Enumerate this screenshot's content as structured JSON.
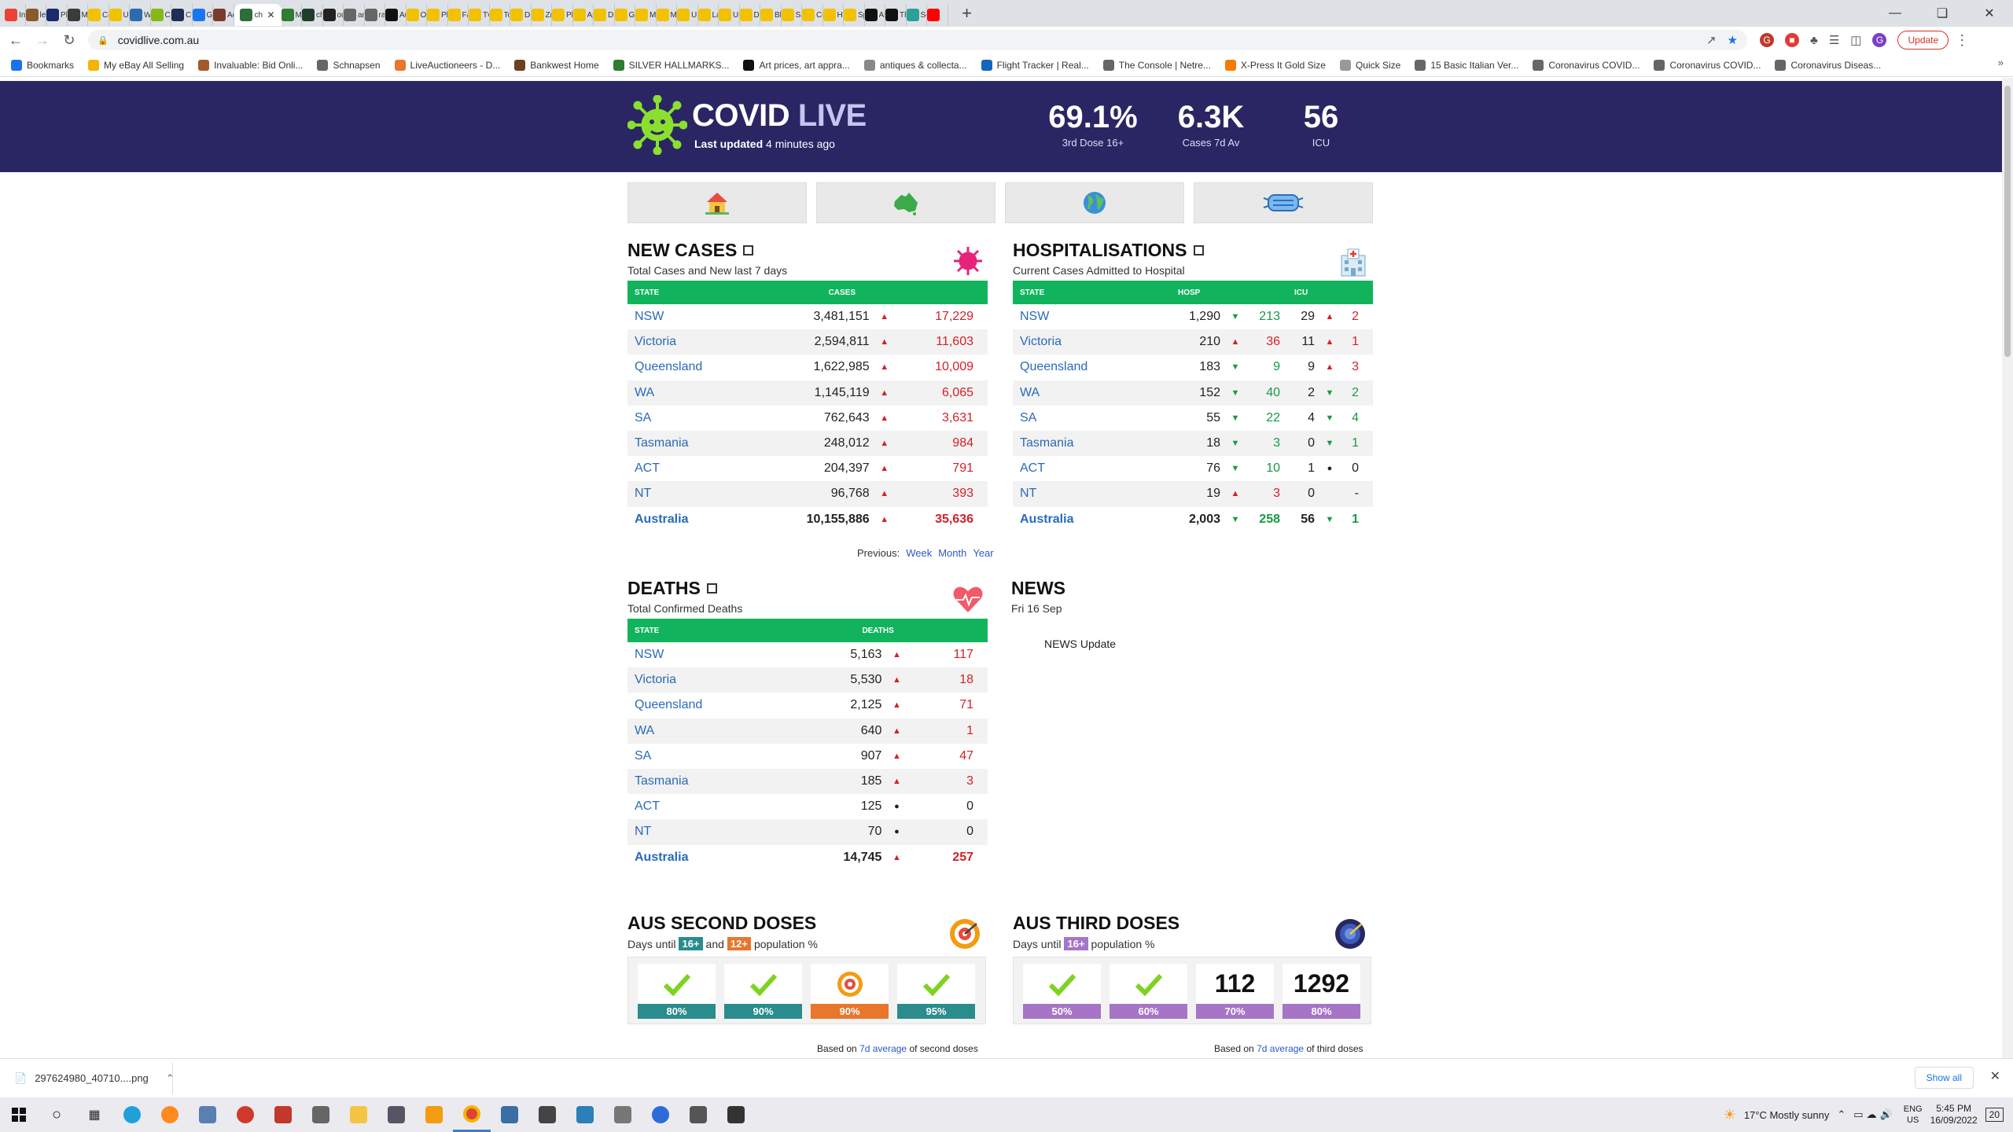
{
  "browser": {
    "tabs": [
      {
        "label": "Inb",
        "color": "#ea4335"
      },
      {
        "label": "le",
        "color": "#8b5a2b"
      },
      {
        "label": "Pl",
        "color": "#1b2a6b"
      },
      {
        "label": "Mi",
        "color": "#3b3b3b"
      },
      {
        "label": "Co",
        "color": "#f2c200"
      },
      {
        "label": "Ur",
        "color": "#f2c200"
      },
      {
        "label": "W",
        "color": "#2b6cb0"
      },
      {
        "label": "CC",
        "color": "#86b817"
      },
      {
        "label": "CC",
        "color": "#1e2f55"
      },
      {
        "label": "Go",
        "color": "#1877f2"
      },
      {
        "label": "Ad",
        "color": "#7a3b2e"
      },
      {
        "label": "ch",
        "color": "#2b6d3b"
      },
      {
        "label": "Mi",
        "color": "#2e7d32"
      },
      {
        "label": "ch",
        "color": "#1f3d2b"
      },
      {
        "label": "ou",
        "color": "#222"
      },
      {
        "label": "an",
        "color": "#666"
      },
      {
        "label": "rai",
        "color": "#666"
      },
      {
        "label": "Au",
        "color": "#111"
      },
      {
        "label": "Or",
        "color": "#f2c200"
      },
      {
        "label": "Pl",
        "color": "#f2c200"
      },
      {
        "label": "Fa",
        "color": "#f2c200"
      },
      {
        "label": "Tv",
        "color": "#f2c200"
      },
      {
        "label": "To",
        "color": "#f2c200"
      },
      {
        "label": "Di",
        "color": "#f2c200"
      },
      {
        "label": "Zn",
        "color": "#f2c200"
      },
      {
        "label": "Pl",
        "color": "#f2c200"
      },
      {
        "label": "Ap",
        "color": "#f2c200"
      },
      {
        "label": "Di",
        "color": "#f2c200"
      },
      {
        "label": "Gu",
        "color": "#f2c200"
      },
      {
        "label": "M",
        "color": "#f2c200"
      },
      {
        "label": "M",
        "color": "#f2c200"
      },
      {
        "label": "Ur",
        "color": "#f2c200"
      },
      {
        "label": "La",
        "color": "#f2c200"
      },
      {
        "label": "Ur",
        "color": "#f2c200"
      },
      {
        "label": "Di",
        "color": "#f2c200"
      },
      {
        "label": "Bl",
        "color": "#f2c200"
      },
      {
        "label": "Sa",
        "color": "#f2c200"
      },
      {
        "label": "Co",
        "color": "#f2c200"
      },
      {
        "label": "Hi",
        "color": "#f2c200"
      },
      {
        "label": "Sp",
        "color": "#f2c200"
      },
      {
        "label": "Al",
        "color": "#111"
      },
      {
        "label": "Th",
        "color": "#111"
      },
      {
        "label": "Sc",
        "color": "#2aa198"
      },
      {
        "label": "",
        "color": "#ff0000"
      }
    ],
    "url": "covidlive.com.au",
    "update_label": "Update",
    "bookmarks": [
      "Bookmarks",
      "My eBay All Selling",
      "Invaluable: Bid Onli...",
      "Schnapsen",
      "LiveAuctioneers - D...",
      "Bankwest Home",
      "SILVER HALLMARKS...",
      "Art prices, art appra...",
      "antiques & collecta...",
      "Flight Tracker | Real...",
      "The Console | Netre...",
      "X-Press It Gold Size",
      "Quick Size",
      "15 Basic Italian Ver...",
      "Coronavirus COVID...",
      "Coronavirus COVID...",
      "Coronavirus Diseas..."
    ]
  },
  "header": {
    "brand_a": "COVID",
    "brand_b": "LIVE",
    "last_updated_prefix": "Last updated",
    "last_updated_value": "4 minutes ago",
    "stats": [
      {
        "value": "69.1%",
        "label": "3rd Dose 16+"
      },
      {
        "value": "6.3K",
        "label": "Cases 7d Av"
      },
      {
        "value": "56",
        "label": "ICU"
      }
    ]
  },
  "new_cases": {
    "title": "NEW CASES",
    "subtitle": "Total Cases and New last 7 days",
    "col_state": "STATE",
    "col_cases": "CASES",
    "rows": [
      {
        "state": "NSW",
        "total": "3,481,151",
        "dir": "up",
        "change": "17,229"
      },
      {
        "state": "Victoria",
        "total": "2,594,811",
        "dir": "up",
        "change": "11,603"
      },
      {
        "state": "Queensland",
        "total": "1,622,985",
        "dir": "up",
        "change": "10,009"
      },
      {
        "state": "WA",
        "total": "1,145,119",
        "dir": "up",
        "change": "6,065"
      },
      {
        "state": "SA",
        "total": "762,643",
        "dir": "up",
        "change": "3,631"
      },
      {
        "state": "Tasmania",
        "total": "248,012",
        "dir": "up",
        "change": "984"
      },
      {
        "state": "ACT",
        "total": "204,397",
        "dir": "up",
        "change": "791"
      },
      {
        "state": "NT",
        "total": "96,768",
        "dir": "up",
        "change": "393"
      },
      {
        "state": "Australia",
        "total": "10,155,886",
        "dir": "up",
        "change": "35,636"
      }
    ],
    "previous_label": "Previous:",
    "links": [
      "Week",
      "Month",
      "Year"
    ]
  },
  "hospital": {
    "title": "HOSPITALISATIONS",
    "subtitle": "Current Cases Admitted to Hospital",
    "col_state": "STATE",
    "col_hosp": "HOSP",
    "col_icu": "ICU",
    "rows": [
      {
        "state": "NSW",
        "hosp": "1,290",
        "hdir": "dn",
        "hch": "213",
        "icu": "29",
        "idir": "up",
        "ich": "2"
      },
      {
        "state": "Victoria",
        "hosp": "210",
        "hdir": "up",
        "hch": "36",
        "icu": "11",
        "idir": "up",
        "ich": "1"
      },
      {
        "state": "Queensland",
        "hosp": "183",
        "hdir": "dn",
        "hch": "9",
        "icu": "9",
        "idir": "up",
        "ich": "3"
      },
      {
        "state": "WA",
        "hosp": "152",
        "hdir": "dn",
        "hch": "40",
        "icu": "2",
        "idir": "dn",
        "ich": "2"
      },
      {
        "state": "SA",
        "hosp": "55",
        "hdir": "dn",
        "hch": "22",
        "icu": "4",
        "idir": "dn",
        "ich": "4"
      },
      {
        "state": "Tasmania",
        "hosp": "18",
        "hdir": "dn",
        "hch": "3",
        "icu": "0",
        "idir": "dn",
        "ich": "1"
      },
      {
        "state": "ACT",
        "hosp": "76",
        "hdir": "dn",
        "hch": "10",
        "icu": "1",
        "idir": "dot",
        "ich": "0"
      },
      {
        "state": "NT",
        "hosp": "19",
        "hdir": "up",
        "hch": "3",
        "icu": "0",
        "idir": "none",
        "ich": "-"
      },
      {
        "state": "Australia",
        "hosp": "2,003",
        "hdir": "dn",
        "hch": "258",
        "icu": "56",
        "idir": "dn",
        "ich": "1"
      }
    ]
  },
  "deaths": {
    "title": "DEATHS",
    "subtitle": "Total Confirmed Deaths",
    "col_state": "STATE",
    "col_deaths": "DEATHS",
    "rows": [
      {
        "state": "NSW",
        "total": "5,163",
        "dir": "up",
        "change": "117"
      },
      {
        "state": "Victoria",
        "total": "5,530",
        "dir": "up",
        "change": "18"
      },
      {
        "state": "Queensland",
        "total": "2,125",
        "dir": "up",
        "change": "71"
      },
      {
        "state": "WA",
        "total": "640",
        "dir": "up",
        "change": "1"
      },
      {
        "state": "SA",
        "total": "907",
        "dir": "up",
        "change": "47"
      },
      {
        "state": "Tasmania",
        "total": "185",
        "dir": "up",
        "change": "3"
      },
      {
        "state": "ACT",
        "total": "125",
        "dir": "dot",
        "change": "0"
      },
      {
        "state": "NT",
        "total": "70",
        "dir": "dot",
        "change": "0"
      },
      {
        "state": "Australia",
        "total": "14,745",
        "dir": "up",
        "change": "257"
      }
    ]
  },
  "news": {
    "title": "NEWS",
    "date": "Fri 16 Sep",
    "update": "NEWS Update"
  },
  "second_doses": {
    "title": "AUS SECOND DOSES",
    "sub_a": "Days until",
    "tag1": "16+",
    "sub_b": "and",
    "tag2": "12+",
    "sub_c": "population %",
    "cards": [
      {
        "top": "check",
        "label": "80%",
        "color": "#2a8c8c"
      },
      {
        "top": "check",
        "label": "90%",
        "color": "#2a8c8c"
      },
      {
        "top": "target",
        "label": "90%",
        "color": "#e8762b"
      },
      {
        "top": "check",
        "label": "95%",
        "color": "#2a8c8c"
      }
    ],
    "based_a": "Based on",
    "based_link": "7d average",
    "based_b": "of second doses"
  },
  "third_doses": {
    "title": "AUS THIRD DOSES",
    "sub_a": "Days until",
    "tag1": "16+",
    "sub_c": "population %",
    "cards": [
      {
        "top": "check",
        "label": "50%",
        "color": "#a675c6"
      },
      {
        "top": "check",
        "label": "60%",
        "color": "#a675c6"
      },
      {
        "top": "112",
        "label": "70%",
        "color": "#a675c6"
      },
      {
        "top": "1292",
        "label": "80%",
        "color": "#a675c6"
      }
    ],
    "based_a": "Based on",
    "based_link": "7d average",
    "based_b": "of third doses"
  },
  "downloads": {
    "file": "297624980_40710....png",
    "show_all": "Show all"
  },
  "taskbar": {
    "weather": "17°C  Mostly sunny",
    "lang": "ENG",
    "region": "US",
    "time": "5:45 PM",
    "date": "16/09/2022",
    "notif": "20"
  },
  "colors": {
    "header_bg": "#2a2664",
    "table_header": "#11b45c",
    "up": "#d51f27",
    "down": "#169a47",
    "link": "#2a6ab8"
  }
}
